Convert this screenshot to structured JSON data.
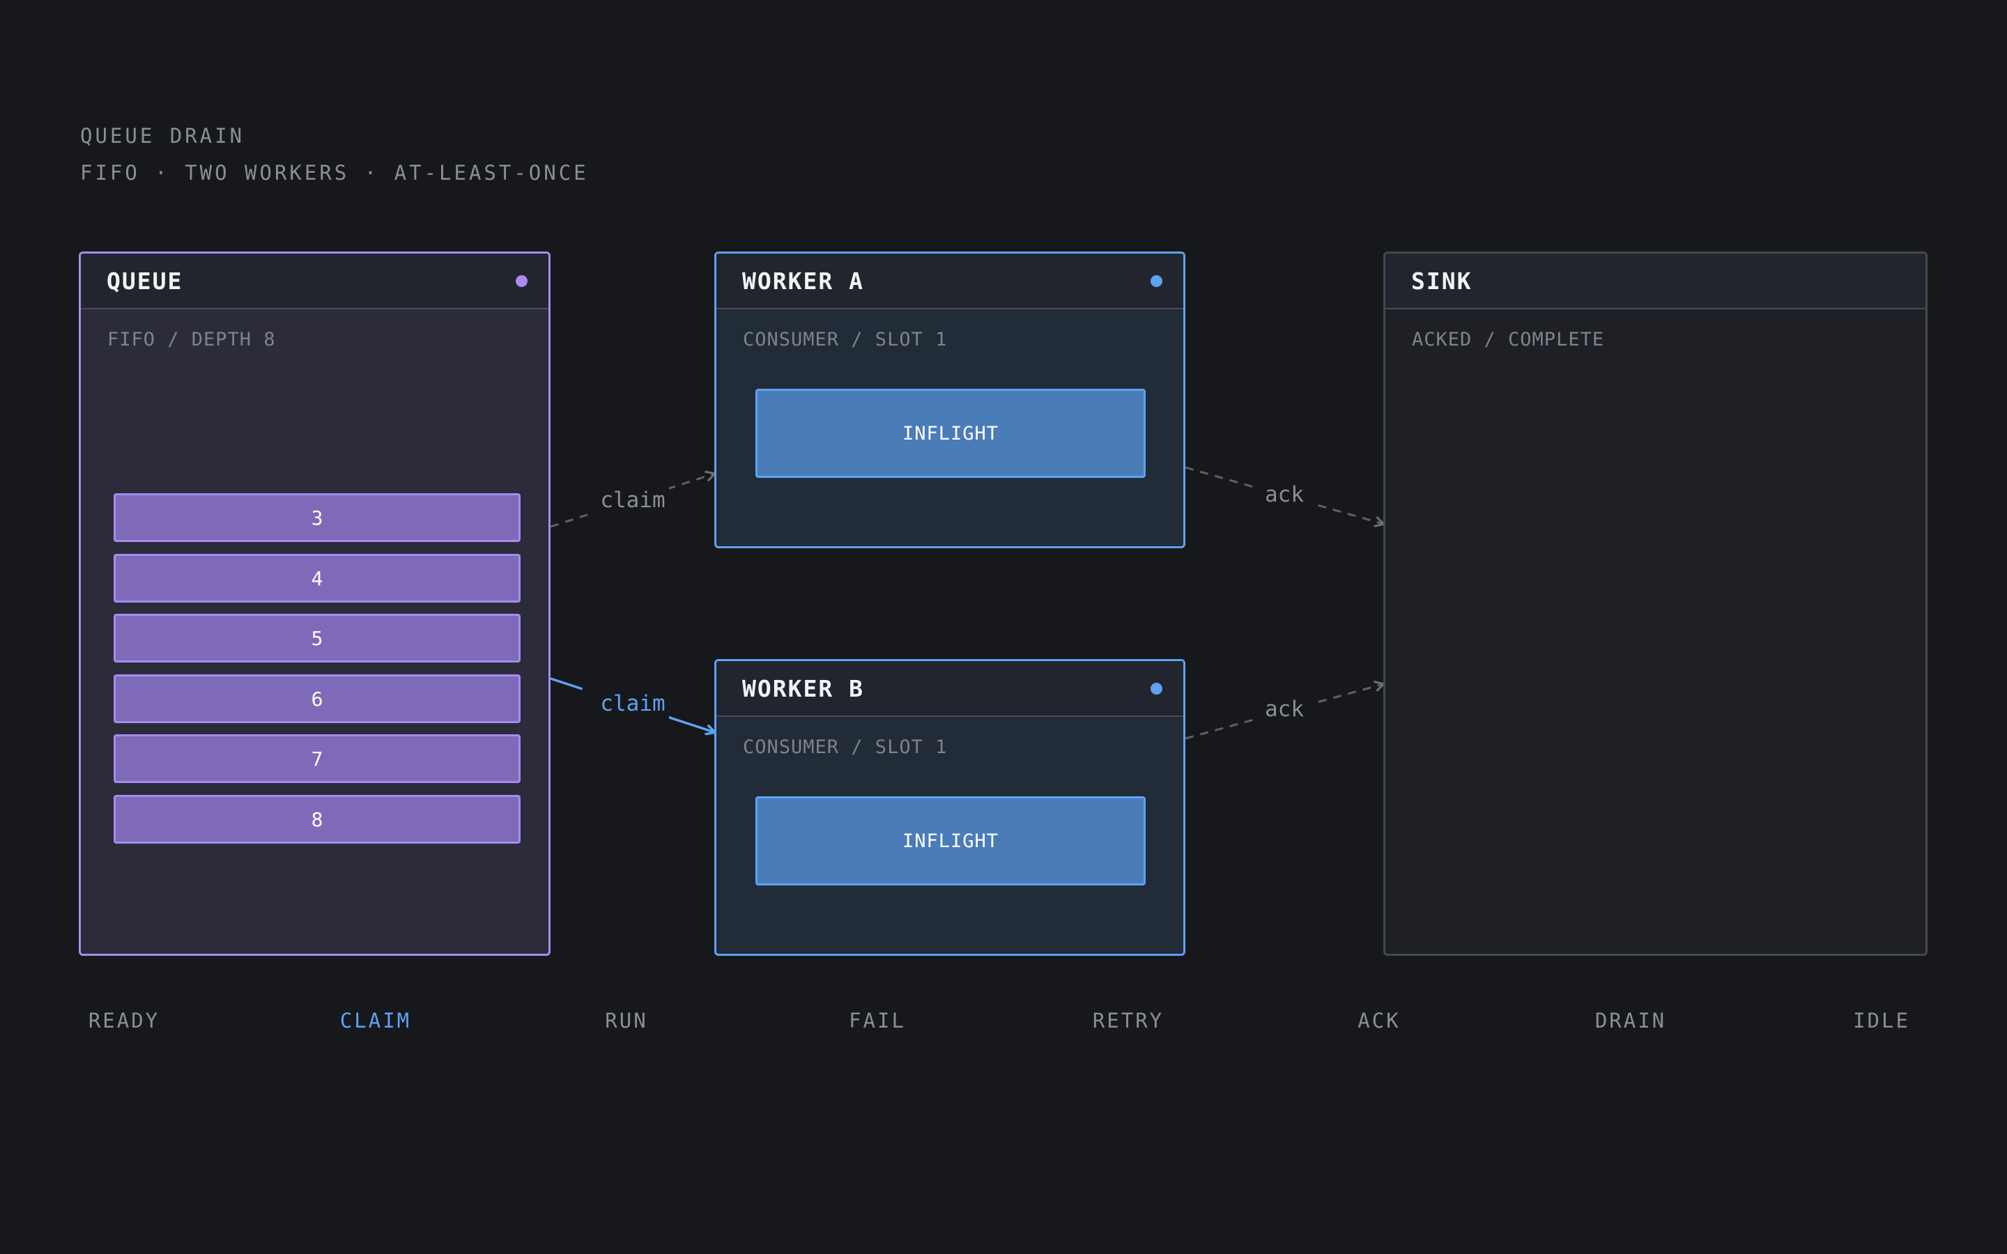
{
  "header": {
    "title": "QUEUE DRAIN",
    "subtitle": "FIFO · TWO WORKERS · AT-LEAST-ONCE"
  },
  "queue": {
    "title": "QUEUE",
    "sub": "FIFO / DEPTH 8",
    "items": [
      "3",
      "4",
      "5",
      "6",
      "7",
      "8"
    ],
    "color": "#a98bf0"
  },
  "worker_a": {
    "title": "WORKER A",
    "sub": "CONSUMER / SLOT 1",
    "job": "INFLIGHT",
    "color": "#5ea2f2"
  },
  "worker_b": {
    "title": "WORKER B",
    "sub": "CONSUMER / SLOT 1",
    "job": "INFLIGHT",
    "color": "#5ea2f2"
  },
  "sink": {
    "title": "SINK",
    "sub": "ACKED / COMPLETE"
  },
  "edges": {
    "claim_a": "claim",
    "claim_b": "claim",
    "ack_a": "ack",
    "ack_b": "ack"
  },
  "steps": [
    "READY",
    "CLAIM",
    "RUN",
    "FAIL",
    "RETRY",
    "ACK",
    "DRAIN",
    "IDLE"
  ],
  "active_step": "CLAIM",
  "colors": {
    "background": "#17181c",
    "accent": "#5ea2f2",
    "queue": "#a98bf0",
    "muted": "#8b8e95"
  }
}
